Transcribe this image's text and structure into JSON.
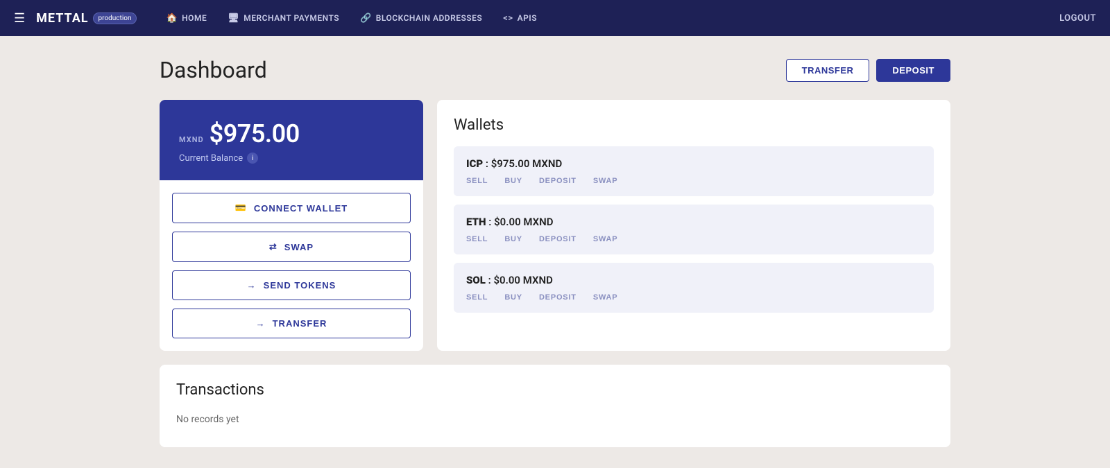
{
  "navbar": {
    "menu_icon": "☰",
    "brand": "METTAL",
    "badge": "production",
    "nav_items": [
      {
        "id": "home",
        "icon": "🏠",
        "label": "HOME"
      },
      {
        "id": "merchant-payments",
        "icon": "🖥",
        "label": "MERCHANT PAYMENTS"
      },
      {
        "id": "blockchain-addresses",
        "icon": "🔗",
        "label": "BLOCKCHAIN ADDRESSES"
      },
      {
        "id": "apis",
        "icon": "<>",
        "label": "APIS"
      }
    ],
    "logout_label": "LOGOUT"
  },
  "page": {
    "title": "Dashboard",
    "header_buttons": {
      "transfer": "TRANSFER",
      "deposit": "DEPOSIT"
    }
  },
  "balance_card": {
    "currency": "MXND",
    "amount": "$975.00",
    "label": "Current Balance"
  },
  "action_buttons": [
    {
      "id": "connect-wallet",
      "icon": "💳",
      "label": "CONNECT WALLET"
    },
    {
      "id": "swap",
      "icon": "⇄",
      "label": "SWAP"
    },
    {
      "id": "send-tokens",
      "icon": "→",
      "label": "SEND TOKENS"
    },
    {
      "id": "transfer",
      "icon": "→",
      "label": "TRANSFER"
    }
  ],
  "wallets": {
    "title": "Wallets",
    "items": [
      {
        "id": "icp",
        "name": "ICP",
        "separator": " : ",
        "amount": "$975.00 MXND",
        "actions": [
          "SELL",
          "BUY",
          "DEPOSIT",
          "SWAP"
        ]
      },
      {
        "id": "eth",
        "name": "ETH",
        "separator": " : ",
        "amount": "$0.00 MXND",
        "actions": [
          "SELL",
          "BUY",
          "DEPOSIT",
          "SWAP"
        ]
      },
      {
        "id": "sol",
        "name": "SOL",
        "separator": " : ",
        "amount": "$0.00 MXND",
        "actions": [
          "SELL",
          "BUY",
          "DEPOSIT",
          "SWAP"
        ]
      }
    ]
  },
  "transactions": {
    "title": "Transactions",
    "empty_message": "No records yet"
  }
}
